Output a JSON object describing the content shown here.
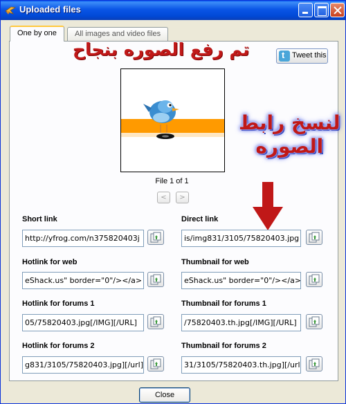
{
  "window": {
    "title": "Uploaded files"
  },
  "tabs": [
    {
      "label": "One by one",
      "active": true
    },
    {
      "label": "All images and video files",
      "active": false
    }
  ],
  "overlay_text": {
    "upload_success": "تم رفع الصوره بنجاح",
    "copy_link_line1": "لنسخ رابط",
    "copy_link_line2": "الصوره"
  },
  "tweet_button": {
    "label": "Tweet this",
    "icon": "twitter-icon"
  },
  "preview": {
    "counter": "File 1 of 1",
    "prev_label": "<",
    "next_label": ">"
  },
  "fields": [
    {
      "label": "Short link",
      "value": "http://yfrog.com/n375820403j"
    },
    {
      "label": "Direct link",
      "value": "is/img831/3105/75820403.jpg"
    },
    {
      "label": "Hotlink for web",
      "value": "eShack.us\" border=\"0\"/></a>"
    },
    {
      "label": "Thumbnail for web",
      "value": "eShack.us\" border=\"0\"/></a>"
    },
    {
      "label": "Hotlink for forums 1",
      "value": "05/75820403.jpg[/IMG][/URL]"
    },
    {
      "label": "Thumbnail for forums 1",
      "value": "/75820403.th.jpg[/IMG][/URL]"
    },
    {
      "label": "Hotlink for forums 2",
      "value": "g831/3105/75820403.jpg][/url]"
    },
    {
      "label": "Thumbnail for forums 2",
      "value": "31/3105/75820403.th.jpg][/url]"
    }
  ],
  "footer": {
    "close_label": "Close"
  },
  "colors": {
    "title_bar": "#0A55E6",
    "arabic_text": "#C01818",
    "arrow": "#C01818"
  }
}
